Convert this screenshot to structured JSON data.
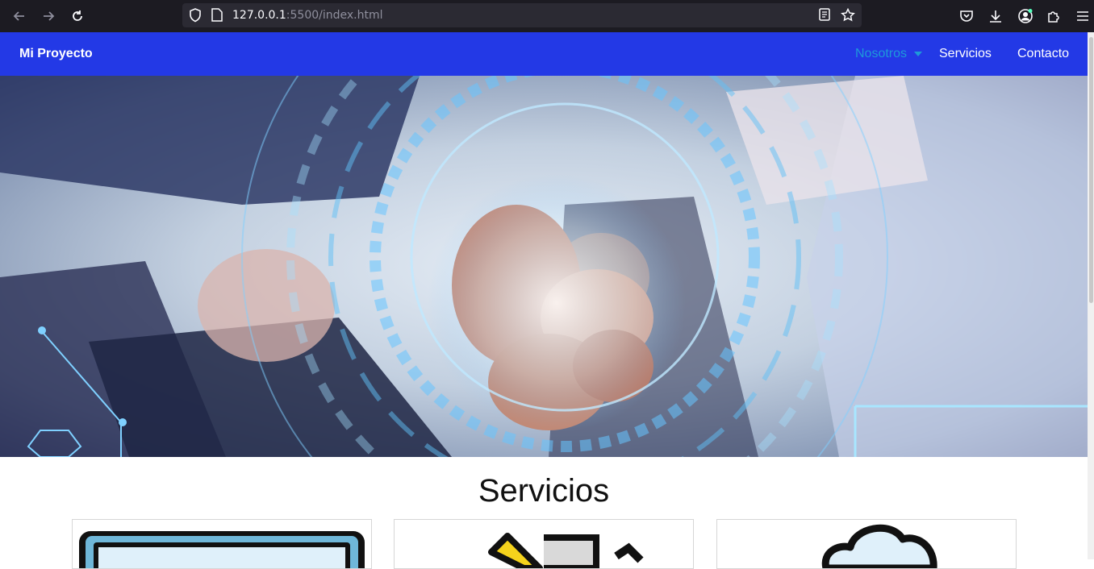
{
  "browser": {
    "url_host": "127.0.0.1",
    "url_rest": ":5500/index.html"
  },
  "navbar": {
    "brand": "Mi Proyecto",
    "items": [
      {
        "label": "Nosotros",
        "dropdown": true,
        "color": "#1e9ad9"
      },
      {
        "label": "Servicios"
      },
      {
        "label": "Contacto"
      }
    ],
    "background": "#2339e6"
  },
  "hero": {
    "image": "team-fist-bump-tech-overlay"
  },
  "services": {
    "title": "Servicios",
    "cards": [
      {
        "icon": "monitor-icon"
      },
      {
        "icon": "tools-icon"
      },
      {
        "icon": "cloud-icon"
      }
    ]
  }
}
